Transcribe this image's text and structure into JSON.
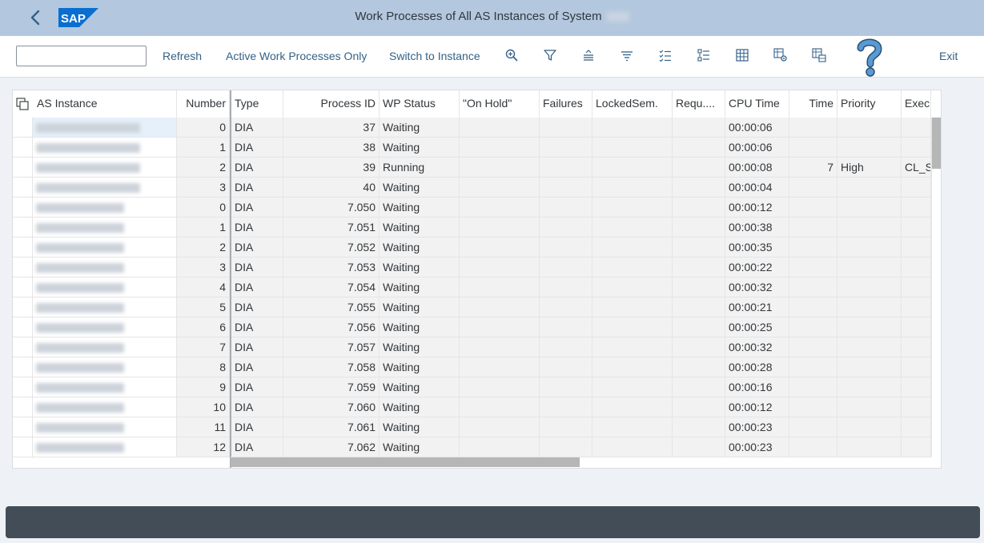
{
  "window": {
    "title": "Work Processes of All AS Instances of System"
  },
  "toolbar": {
    "command_value": "",
    "refresh": "Refresh",
    "active_only": "Active Work Processes Only",
    "switch_instance": "Switch to Instance",
    "exit": "Exit",
    "icons": [
      "zoom-icon",
      "filter-icon",
      "sort-ascending-icon",
      "filter-lines-icon",
      "select-all-icon",
      "details-icon",
      "grid-icon",
      "grid-settings-icon",
      "layout-icon"
    ]
  },
  "table": {
    "columns": [
      {
        "key": "instance",
        "label": "AS Instance"
      },
      {
        "key": "number",
        "label": "Number"
      },
      {
        "key": "type",
        "label": "Type"
      },
      {
        "key": "pid",
        "label": "Process ID"
      },
      {
        "key": "status",
        "label": "WP Status"
      },
      {
        "key": "onhold",
        "label": "\"On Hold\""
      },
      {
        "key": "failures",
        "label": "Failures"
      },
      {
        "key": "locked",
        "label": "LockedSem."
      },
      {
        "key": "requ",
        "label": "Requ...."
      },
      {
        "key": "cpu",
        "label": "CPU Time"
      },
      {
        "key": "time",
        "label": "Time"
      },
      {
        "key": "priority",
        "label": "Priority"
      },
      {
        "key": "exec",
        "label": "Execu"
      }
    ],
    "rows": [
      {
        "number": "0",
        "type": "DIA",
        "pid": "37",
        "status": "Waiting",
        "cpu": "00:00:06",
        "time": "",
        "priority": "",
        "exec": ""
      },
      {
        "number": "1",
        "type": "DIA",
        "pid": "38",
        "status": "Waiting",
        "cpu": "00:00:06",
        "time": "",
        "priority": "",
        "exec": ""
      },
      {
        "number": "2",
        "type": "DIA",
        "pid": "39",
        "status": "Running",
        "cpu": "00:00:08",
        "time": "7",
        "priority": "High",
        "exec": "CL_S"
      },
      {
        "number": "3",
        "type": "DIA",
        "pid": "40",
        "status": "Waiting",
        "cpu": "00:00:04",
        "time": "",
        "priority": "",
        "exec": ""
      },
      {
        "number": "0",
        "type": "DIA",
        "pid": "7.050",
        "status": "Waiting",
        "cpu": "00:00:12",
        "time": "",
        "priority": "",
        "exec": ""
      },
      {
        "number": "1",
        "type": "DIA",
        "pid": "7.051",
        "status": "Waiting",
        "cpu": "00:00:38",
        "time": "",
        "priority": "",
        "exec": ""
      },
      {
        "number": "2",
        "type": "DIA",
        "pid": "7.052",
        "status": "Waiting",
        "cpu": "00:00:35",
        "time": "",
        "priority": "",
        "exec": ""
      },
      {
        "number": "3",
        "type": "DIA",
        "pid": "7.053",
        "status": "Waiting",
        "cpu": "00:00:22",
        "time": "",
        "priority": "",
        "exec": ""
      },
      {
        "number": "4",
        "type": "DIA",
        "pid": "7.054",
        "status": "Waiting",
        "cpu": "00:00:32",
        "time": "",
        "priority": "",
        "exec": ""
      },
      {
        "number": "5",
        "type": "DIA",
        "pid": "7.055",
        "status": "Waiting",
        "cpu": "00:00:21",
        "time": "",
        "priority": "",
        "exec": ""
      },
      {
        "number": "6",
        "type": "DIA",
        "pid": "7.056",
        "status": "Waiting",
        "cpu": "00:00:25",
        "time": "",
        "priority": "",
        "exec": ""
      },
      {
        "number": "7",
        "type": "DIA",
        "pid": "7.057",
        "status": "Waiting",
        "cpu": "00:00:32",
        "time": "",
        "priority": "",
        "exec": ""
      },
      {
        "number": "8",
        "type": "DIA",
        "pid": "7.058",
        "status": "Waiting",
        "cpu": "00:00:28",
        "time": "",
        "priority": "",
        "exec": ""
      },
      {
        "number": "9",
        "type": "DIA",
        "pid": "7.059",
        "status": "Waiting",
        "cpu": "00:00:16",
        "time": "",
        "priority": "",
        "exec": ""
      },
      {
        "number": "10",
        "type": "DIA",
        "pid": "7.060",
        "status": "Waiting",
        "cpu": "00:00:12",
        "time": "",
        "priority": "",
        "exec": ""
      },
      {
        "number": "11",
        "type": "DIA",
        "pid": "7.061",
        "status": "Waiting",
        "cpu": "00:00:23",
        "time": "",
        "priority": "",
        "exec": ""
      },
      {
        "number": "12",
        "type": "DIA",
        "pid": "7.062",
        "status": "Waiting",
        "cpu": "00:00:23",
        "time": "",
        "priority": "",
        "exec": ""
      }
    ]
  },
  "colors": {
    "shell": "#b3c8df",
    "link": "#346187",
    "footer": "#434d58",
    "sap_blue": "#0a6ed1",
    "help": "#4a86bf"
  }
}
